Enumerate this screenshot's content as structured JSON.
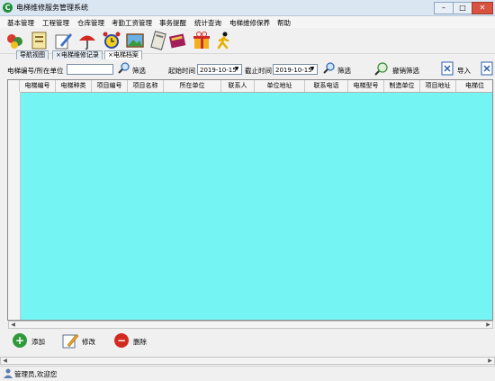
{
  "window": {
    "title": "电梯维修服务管理系统"
  },
  "menu": [
    "基本管理",
    "工程管理",
    "仓库管理",
    "考勤工资管理",
    "事务提醒",
    "统计查询",
    "电梯维修保养",
    "帮助"
  ],
  "tabs": [
    "导航视图",
    "×电梯维修记录",
    "×电梯档案"
  ],
  "filter": {
    "elevator_label": "电梯编号/所在单位",
    "elevator_value": "",
    "filter_btn": "筛选",
    "start_label": "起始时间",
    "start_value": "2019-10-15",
    "end_label": "截止时间",
    "end_value": "2019-10-15",
    "filter_btn2": "筛选",
    "cancel_filter": "撤销筛选",
    "import_btn": "导入"
  },
  "table": {
    "columns": [
      "电梯编号",
      "电梯种类",
      "项目编号",
      "项目名称",
      "所在单位",
      "联系人",
      "单位地址",
      "联系电话",
      "电梯型号",
      "制造单位",
      "项目地址",
      "电梯位"
    ]
  },
  "actions": {
    "add": "添加",
    "edit": "修改",
    "delete": "删除"
  },
  "status": {
    "text": "管理员,欢迎您"
  },
  "colors": {
    "grid_bg": "#75f4f4",
    "close_btn": "#d7523f",
    "add_green": "#2e9a3a",
    "delete_red": "#d12b20"
  }
}
